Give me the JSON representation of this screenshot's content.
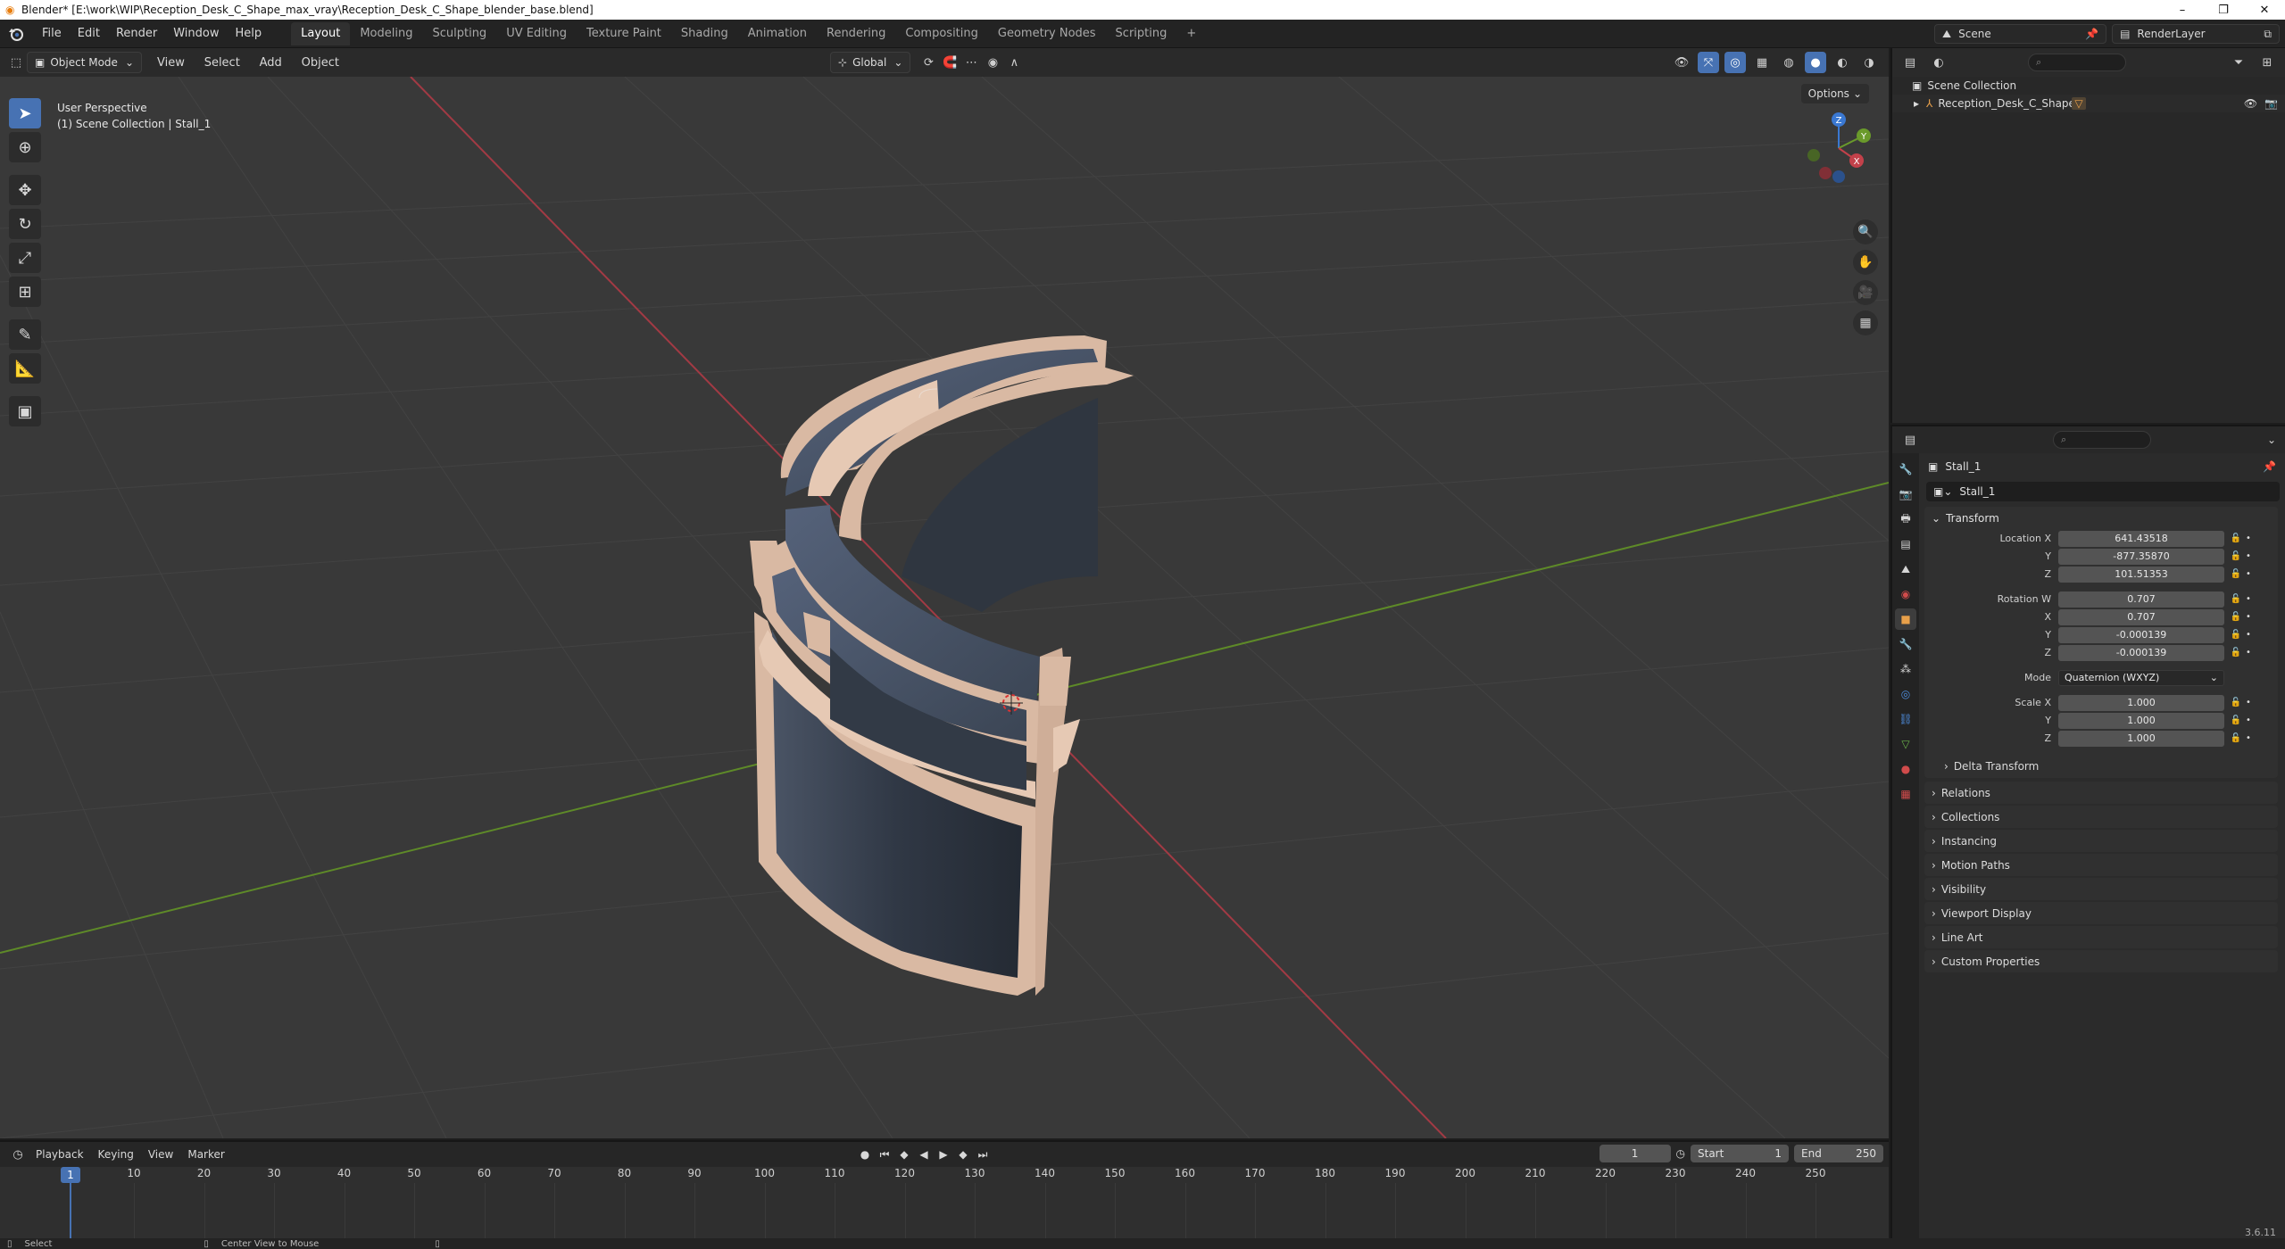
{
  "window": {
    "title": "Blender* [E:\\work\\WIP\\Reception_Desk_C_Shape_max_vray\\Reception_Desk_C_Shape_blender_base.blend]"
  },
  "topbar": {
    "menu": [
      "File",
      "Edit",
      "Render",
      "Window",
      "Help"
    ],
    "workspaces": [
      "Layout",
      "Modeling",
      "Sculpting",
      "UV Editing",
      "Texture Paint",
      "Shading",
      "Animation",
      "Rendering",
      "Compositing",
      "Geometry Nodes",
      "Scripting"
    ],
    "active_workspace": "Layout",
    "add_tab": "+",
    "scene": "Scene",
    "view_layer": "RenderLayer"
  },
  "viewport_header": {
    "mode": "Object Mode",
    "menu": [
      "View",
      "Select",
      "Add",
      "Object"
    ],
    "orientation": "Global",
    "options": "Options"
  },
  "viewport": {
    "view_name": "User Perspective",
    "collection_info": "(1) Scene Collection | Stall_1",
    "gizmo_axes": [
      "X",
      "Y",
      "Z"
    ],
    "colors": {
      "x_axis": "#c3414a",
      "y_axis": "#6a9a2b",
      "z_axis": "#3a78d2",
      "background": "#393939",
      "desk_trim": "#d9b9a3",
      "desk_panel": "#3d4756"
    }
  },
  "timeline": {
    "menu": [
      "Playback",
      "Keying",
      "View",
      "Marker"
    ],
    "current_frame": "1",
    "start_label": "Start",
    "start": "1",
    "end_label": "End",
    "end": "250",
    "ticks": [
      "10",
      "20",
      "30",
      "40",
      "50",
      "60",
      "70",
      "80",
      "90",
      "100",
      "110",
      "120",
      "130",
      "140",
      "150",
      "160",
      "170",
      "180",
      "190",
      "200",
      "210",
      "220",
      "230",
      "240",
      "250"
    ],
    "playhead": "1"
  },
  "outliner": {
    "root": "Scene Collection",
    "items": [
      {
        "name": "Reception_Desk_C_Shape"
      }
    ]
  },
  "properties": {
    "object_name": "Stall_1",
    "object_field": "Stall_1",
    "transform": {
      "title": "Transform",
      "location": {
        "label": "Location X",
        "x": "641.43518",
        "y": "-877.35870",
        "z": "101.51353"
      },
      "rotation": {
        "label": "Rotation W",
        "w": "0.707",
        "x": "0.707",
        "y": "-0.000139",
        "z": "-0.000139"
      },
      "mode_label": "Mode",
      "mode": "Quaternion (WXYZ)",
      "scale": {
        "label": "Scale X",
        "x": "1.000",
        "y": "1.000",
        "z": "1.000"
      },
      "axis_labels": {
        "x": "X",
        "y": "Y",
        "z": "Z"
      },
      "delta": "Delta Transform"
    },
    "panels": [
      "Relations",
      "Collections",
      "Instancing",
      "Motion Paths",
      "Visibility",
      "Viewport Display",
      "Line Art",
      "Custom Properties"
    ]
  },
  "statusbar": {
    "left": "Select",
    "middle": "Center View to Mouse",
    "version": "3.6.11"
  }
}
